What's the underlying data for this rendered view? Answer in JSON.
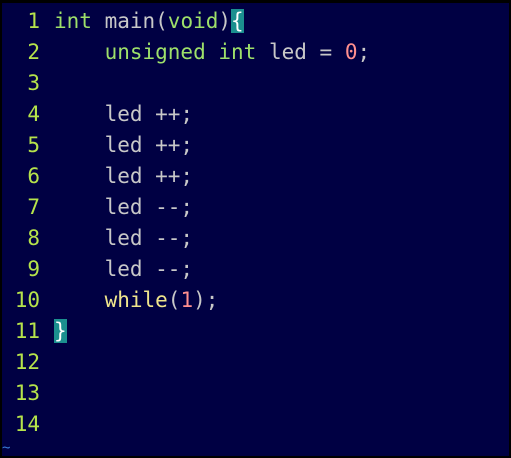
{
  "editor": {
    "lines": [
      {
        "num": "1",
        "tokens": [
          {
            "t": "int",
            "c": "type"
          },
          {
            "t": " main(",
            "c": "default"
          },
          {
            "t": "void",
            "c": "type"
          },
          {
            "t": ")",
            "c": "default"
          },
          {
            "t": "{",
            "c": "cursor"
          }
        ]
      },
      {
        "num": "2",
        "tokens": [
          {
            "t": "    ",
            "c": "default"
          },
          {
            "t": "unsigned",
            "c": "type"
          },
          {
            "t": " ",
            "c": "default"
          },
          {
            "t": "int",
            "c": "type"
          },
          {
            "t": " led = ",
            "c": "default"
          },
          {
            "t": "0",
            "c": "num"
          },
          {
            "t": ";",
            "c": "default"
          }
        ]
      },
      {
        "num": "3",
        "tokens": []
      },
      {
        "num": "4",
        "tokens": [
          {
            "t": "    led ++;",
            "c": "default"
          }
        ]
      },
      {
        "num": "5",
        "tokens": [
          {
            "t": "    led ++;",
            "c": "default"
          }
        ]
      },
      {
        "num": "6",
        "tokens": [
          {
            "t": "    led ++;",
            "c": "default"
          }
        ]
      },
      {
        "num": "7",
        "tokens": [
          {
            "t": "    led --;",
            "c": "default"
          }
        ]
      },
      {
        "num": "8",
        "tokens": [
          {
            "t": "    led --;",
            "c": "default"
          }
        ]
      },
      {
        "num": "9",
        "tokens": [
          {
            "t": "    led --;",
            "c": "default"
          }
        ]
      },
      {
        "num": "10",
        "tokens": [
          {
            "t": "    ",
            "c": "default"
          },
          {
            "t": "while",
            "c": "kw"
          },
          {
            "t": "(",
            "c": "default"
          },
          {
            "t": "1",
            "c": "num"
          },
          {
            "t": ");",
            "c": "default"
          }
        ]
      },
      {
        "num": "11",
        "tokens": [
          {
            "t": "}",
            "c": "cursor"
          }
        ]
      },
      {
        "num": "12",
        "tokens": []
      },
      {
        "num": "13",
        "tokens": []
      },
      {
        "num": "14",
        "tokens": []
      }
    ],
    "end_marker": "~"
  },
  "colors": {
    "background": "#000043",
    "line_number": "#b6e34b",
    "type": "#9ee06a",
    "keyword": "#f0e68c",
    "number": "#ff8f8f",
    "match_highlight": "#1b8f8f"
  }
}
